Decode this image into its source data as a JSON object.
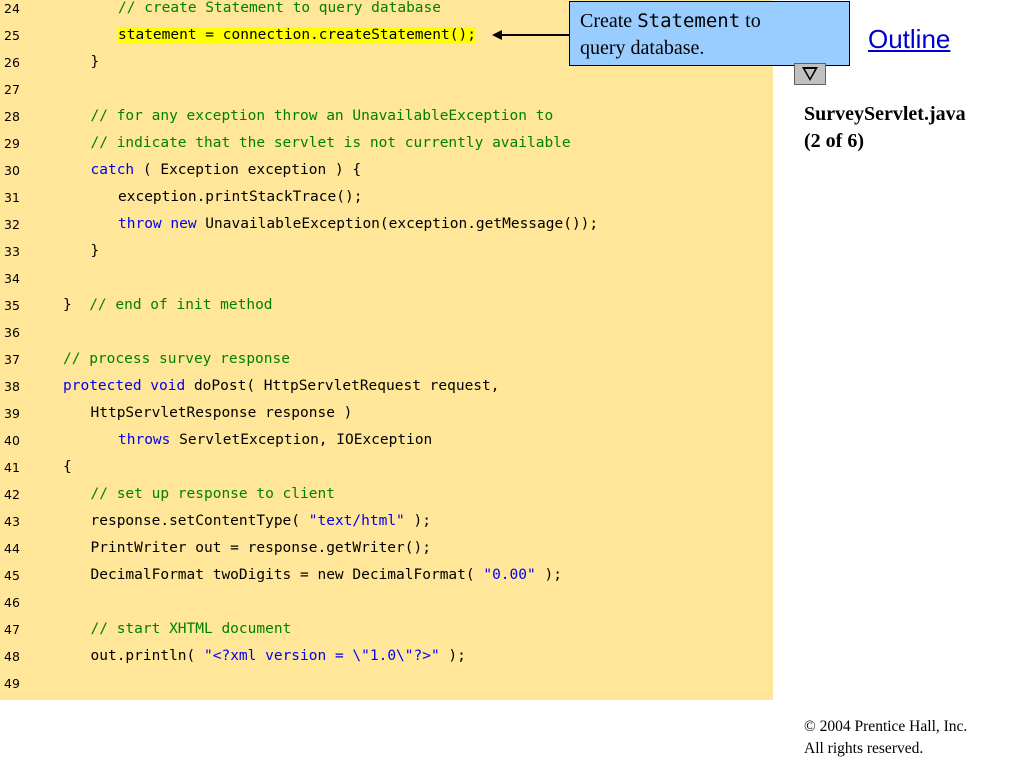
{
  "slide": {
    "outline_label": "Outline",
    "file_name": "SurveyServlet.java",
    "page_indicator": "(2 of 6)",
    "callout": {
      "prefix": "Create ",
      "code": "Statement",
      "suffix": " to",
      "line2": "query database."
    },
    "copyright_line1": "© 2004 Prentice Hall, Inc.",
    "copyright_line2": "All rights reserved.",
    "colors": {
      "code_background": "#ffe699",
      "callout_background": "#99ccff",
      "comment": "#008000",
      "keyword": "#0000ee",
      "highlight": "#ffff00",
      "link": "#0000cc"
    },
    "icons": {
      "next": "triangle-down-icon"
    }
  },
  "code_lines": [
    {
      "num": "24",
      "indent": 4,
      "segments": [
        {
          "t": "comment",
          "text": "// create Statement to query database"
        }
      ]
    },
    {
      "num": "25",
      "indent": 4,
      "segments": [
        {
          "t": "highlight",
          "text": "statement = connection.createStatement();"
        }
      ]
    },
    {
      "num": "26",
      "indent": 3,
      "segments": [
        {
          "t": "plain",
          "text": "}"
        }
      ]
    },
    {
      "num": "27",
      "indent": 0,
      "segments": []
    },
    {
      "num": "28",
      "indent": 3,
      "segments": [
        {
          "t": "comment",
          "text": "// for any exception throw an UnavailableException to"
        }
      ]
    },
    {
      "num": "29",
      "indent": 3,
      "segments": [
        {
          "t": "comment",
          "text": "// indicate that the servlet is not currently available"
        }
      ]
    },
    {
      "num": "30",
      "indent": 3,
      "segments": [
        {
          "t": "keyword",
          "text": "catch"
        },
        {
          "t": "plain",
          "text": " ( Exception exception ) {"
        }
      ]
    },
    {
      "num": "31",
      "indent": 4,
      "segments": [
        {
          "t": "plain",
          "text": "exception.printStackTrace();"
        }
      ]
    },
    {
      "num": "32",
      "indent": 4,
      "segments": [
        {
          "t": "keyword",
          "text": "throw new"
        },
        {
          "t": "plain",
          "text": " UnavailableException(exception.getMessage());"
        }
      ]
    },
    {
      "num": "33",
      "indent": 3,
      "segments": [
        {
          "t": "plain",
          "text": "}"
        }
      ]
    },
    {
      "num": "34",
      "indent": 0,
      "segments": []
    },
    {
      "num": "35",
      "indent": 2,
      "segments": [
        {
          "t": "plain",
          "text": "}  "
        },
        {
          "t": "comment",
          "text": "// end of init method"
        }
      ]
    },
    {
      "num": "36",
      "indent": 0,
      "segments": []
    },
    {
      "num": "37",
      "indent": 2,
      "segments": [
        {
          "t": "comment",
          "text": "// process survey response"
        }
      ]
    },
    {
      "num": "38",
      "indent": 2,
      "segments": [
        {
          "t": "keyword",
          "text": "protected void"
        },
        {
          "t": "plain",
          "text": " doPost( HttpServletRequest request,"
        }
      ]
    },
    {
      "num": "39",
      "indent": 3,
      "segments": [
        {
          "t": "plain",
          "text": "HttpServletResponse response )"
        }
      ]
    },
    {
      "num": "40",
      "indent": 4,
      "segments": [
        {
          "t": "keyword",
          "text": "throws"
        },
        {
          "t": "plain",
          "text": " ServletException, IOException"
        }
      ]
    },
    {
      "num": "41",
      "indent": 2,
      "segments": [
        {
          "t": "plain",
          "text": "{"
        }
      ]
    },
    {
      "num": "42",
      "indent": 3,
      "segments": [
        {
          "t": "comment",
          "text": "// set up response to client"
        }
      ]
    },
    {
      "num": "43",
      "indent": 3,
      "segments": [
        {
          "t": "plain",
          "text": "response.setContentType( "
        },
        {
          "t": "string",
          "text": "\"text/html\""
        },
        {
          "t": "plain",
          "text": " );"
        }
      ]
    },
    {
      "num": "44",
      "indent": 3,
      "segments": [
        {
          "t": "plain",
          "text": "PrintWriter out = response.getWriter();"
        }
      ]
    },
    {
      "num": "45",
      "indent": 3,
      "segments": [
        {
          "t": "plain",
          "text": "DecimalFormat twoDigits = new DecimalFormat( "
        },
        {
          "t": "string",
          "text": "\"0.00\""
        },
        {
          "t": "plain",
          "text": " );"
        }
      ]
    },
    {
      "num": "46",
      "indent": 0,
      "segments": []
    },
    {
      "num": "47",
      "indent": 3,
      "segments": [
        {
          "t": "comment",
          "text": "// start XHTML document"
        }
      ]
    },
    {
      "num": "48",
      "indent": 3,
      "segments": [
        {
          "t": "plain",
          "text": "out.println( "
        },
        {
          "t": "string",
          "text": "\"<?xml version = \\\"1.0\\\"?>\""
        },
        {
          "t": "plain",
          "text": " );"
        }
      ]
    },
    {
      "num": "49",
      "indent": 0,
      "segments": []
    }
  ]
}
